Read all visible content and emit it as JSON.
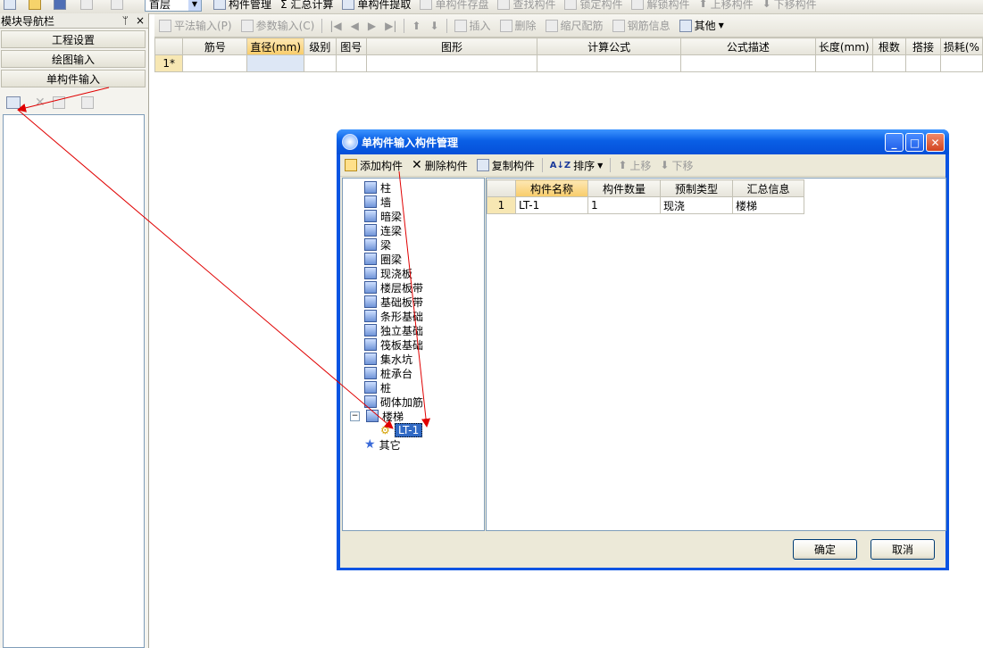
{
  "top_toolbar": {
    "floor_select": "首层",
    "items": [
      "构件管理",
      "Σ 汇总计算",
      "单构件提取",
      "单构件存盘",
      "查找构件",
      "锁定构件",
      "解锁构件",
      "上移构件",
      "下移构件"
    ]
  },
  "toolbar2": {
    "pingfa": "平法输入(P)",
    "canshu": "参数输入(C)",
    "insert": "插入",
    "delete": "删除",
    "suochi": "缩尺配筋",
    "gangjin": "钢筋信息",
    "other": "其他"
  },
  "nav": {
    "title": "模块导航栏",
    "pin": "ᛘ",
    "close": "×",
    "buttons": [
      "工程设置",
      "绘图输入",
      "单构件输入"
    ]
  },
  "grid": {
    "headers": [
      "",
      "筋号",
      "直径(mm)",
      "级别",
      "图号",
      "图形",
      "计算公式",
      "公式描述",
      "长度(mm)",
      "根数",
      "搭接",
      "损耗(%"
    ],
    "row_label": "1*"
  },
  "dialog": {
    "title": "单构件输入构件管理",
    "toolbar": {
      "add": "添加构件",
      "delete": "删除构件",
      "copy": "复制构件",
      "sort": "排序",
      "up": "上移",
      "down": "下移"
    },
    "tree": [
      "柱",
      "墙",
      "暗梁",
      "连梁",
      "梁",
      "圈梁",
      "现浇板",
      "楼层板带",
      "基础板带",
      "条形基础",
      "独立基础",
      "筏板基础",
      "集水坑",
      "桩承台",
      "桩",
      "砌体加筋",
      "楼梯",
      "LT-1",
      "其它"
    ],
    "table": {
      "headers": [
        "",
        "构件名称",
        "构件数量",
        "预制类型",
        "汇总信息"
      ],
      "rows": [
        [
          "1",
          "LT-1",
          "1",
          "现浇",
          "楼梯"
        ]
      ]
    },
    "ok": "确定",
    "cancel": "取消"
  },
  "colors": {
    "title_blue": "#0a54e3",
    "header_highlight": "#f8cc6a",
    "arrow": "#e00000",
    "selection": "#316ac5"
  }
}
